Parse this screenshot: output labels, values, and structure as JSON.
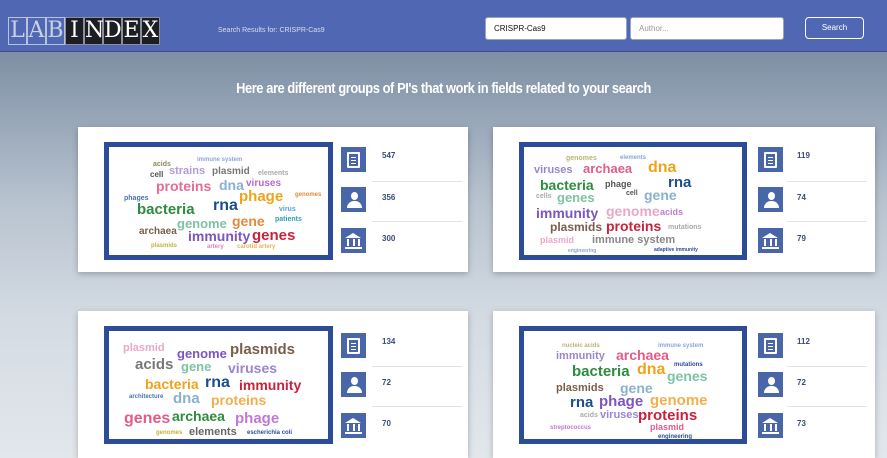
{
  "header": {
    "logo_lab": [
      "L",
      "A",
      "B"
    ],
    "logo_index": [
      "I",
      "N",
      "D",
      "E",
      "X"
    ],
    "breadcrumb": "Search Results for: CRISPR-Cas9",
    "search_value": "CRISPR-Cas9",
    "author_placeholder": "Author...",
    "search_button": "Search"
  },
  "heading": "Here are different groups of PI's that work in fields related to your search",
  "colors": {
    "topbar": "#5068b4",
    "cloud_border": "#2c4c98",
    "stat_icon": "#4966a8"
  },
  "groups": [
    {
      "stats": {
        "publications": "547",
        "people": "356",
        "institutions": "300"
      },
      "words": [
        "acids",
        "immune system",
        "cell",
        "strains",
        "plasmid",
        "elements",
        "proteins",
        "dna",
        "viruses",
        "phages",
        "genomes",
        "phage",
        "bacteria",
        "rna",
        "virus",
        "genome",
        "gene",
        "patients",
        "archaea",
        "immunity",
        "genes",
        "plasmids",
        "artery",
        "carotid artery"
      ]
    },
    {
      "stats": {
        "publications": "119",
        "people": "74",
        "institutions": "79"
      },
      "words": [
        "genomes",
        "elements",
        "viruses",
        "archaea",
        "dna",
        "bacteria",
        "phage",
        "rna",
        "cells",
        "genes",
        "cell",
        "gene",
        "immunity",
        "genome",
        "acids",
        "plasmids",
        "proteins",
        "mutations",
        "plasmid",
        "immune system",
        "engineering",
        "adaptive immunity"
      ]
    },
    {
      "stats": {
        "publications": "134",
        "people": "72",
        "institutions": "70"
      },
      "words": [
        "plasmid",
        "genome",
        "plasmids",
        "acids",
        "gene",
        "viruses",
        "bacteria",
        "rna",
        "immunity",
        "architecture",
        "dna",
        "proteins",
        "genes",
        "archaea",
        "phage",
        "genomes",
        "elements",
        "escherichia coli"
      ]
    },
    {
      "stats": {
        "publications": "112",
        "people": "72",
        "institutions": "73"
      },
      "words": [
        "nucleic acids",
        "immune system",
        "immunity",
        "archaea",
        "bacteria",
        "dna",
        "mutations",
        "genes",
        "plasmids",
        "gene",
        "rna",
        "phage",
        "genome",
        "acids",
        "viruses",
        "proteins",
        "streptococcus",
        "plasmid",
        "engineering"
      ]
    }
  ]
}
